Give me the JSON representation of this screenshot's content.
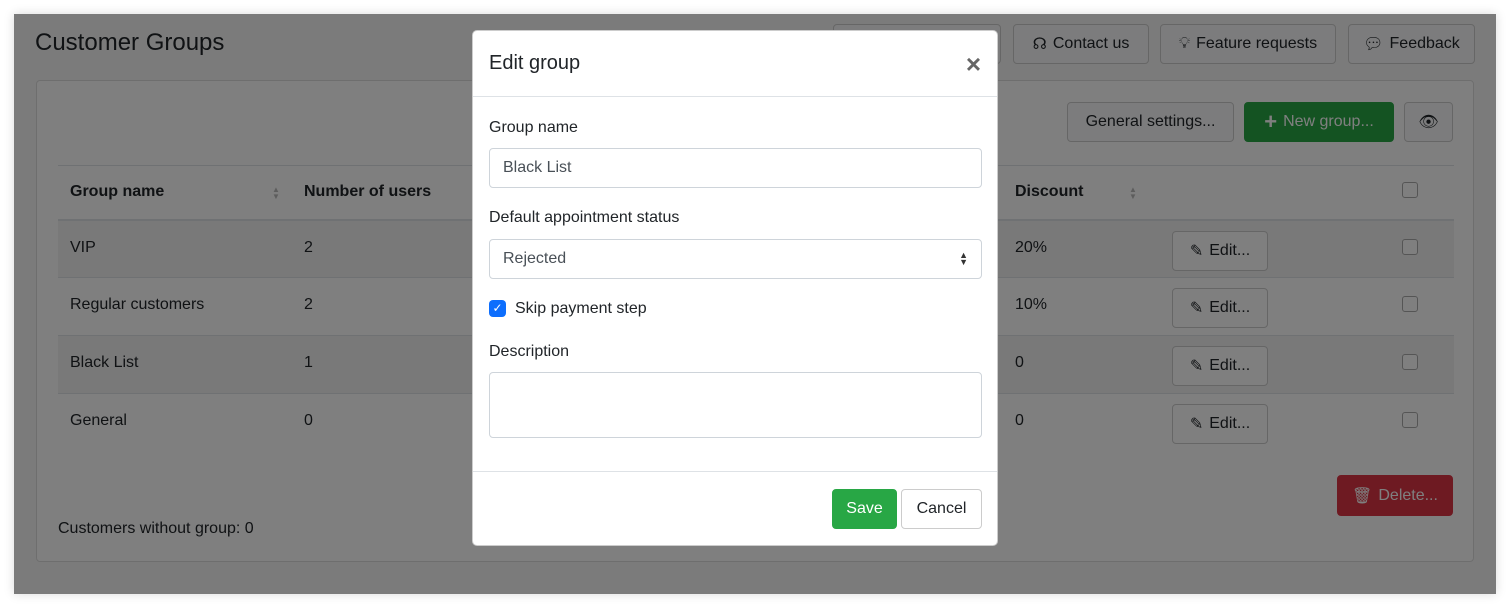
{
  "page": {
    "title": "Customer Groups"
  },
  "top_buttons": [
    {
      "label": "",
      "icon": "hidden"
    },
    {
      "label": "Contact us",
      "icon": "headset-icon"
    },
    {
      "label": "Feature requests",
      "icon": "lightbulb-icon"
    },
    {
      "label": "Feedback",
      "icon": "chat-icon"
    }
  ],
  "toolbar": {
    "general_settings": "General settings...",
    "new_group": "New group...",
    "eye_icon": "eye-icon"
  },
  "table": {
    "headers": [
      "Group name",
      "Number of users",
      "Discount"
    ],
    "rows": [
      {
        "name": "VIP",
        "users": "2",
        "discount": "20%"
      },
      {
        "name": "Regular customers",
        "users": "2",
        "discount": "10%"
      },
      {
        "name": "Black List",
        "users": "1",
        "discount": "0"
      },
      {
        "name": "General",
        "users": "0",
        "discount": "0"
      }
    ],
    "edit_label": "Edit..."
  },
  "delete_label": "Delete...",
  "footer_text": "Customers without group: 0",
  "modal": {
    "title": "Edit group",
    "group_name_label": "Group name",
    "group_name_value": "Black List",
    "status_label": "Default appointment status",
    "status_value": "Rejected",
    "skip_payment_label": "Skip payment step",
    "skip_payment_checked": true,
    "description_label": "Description",
    "description_value": "",
    "save": "Save",
    "cancel": "Cancel"
  },
  "colors": {
    "success": "#28a745",
    "danger": "#dc3545",
    "primary": "#0d6efd"
  }
}
